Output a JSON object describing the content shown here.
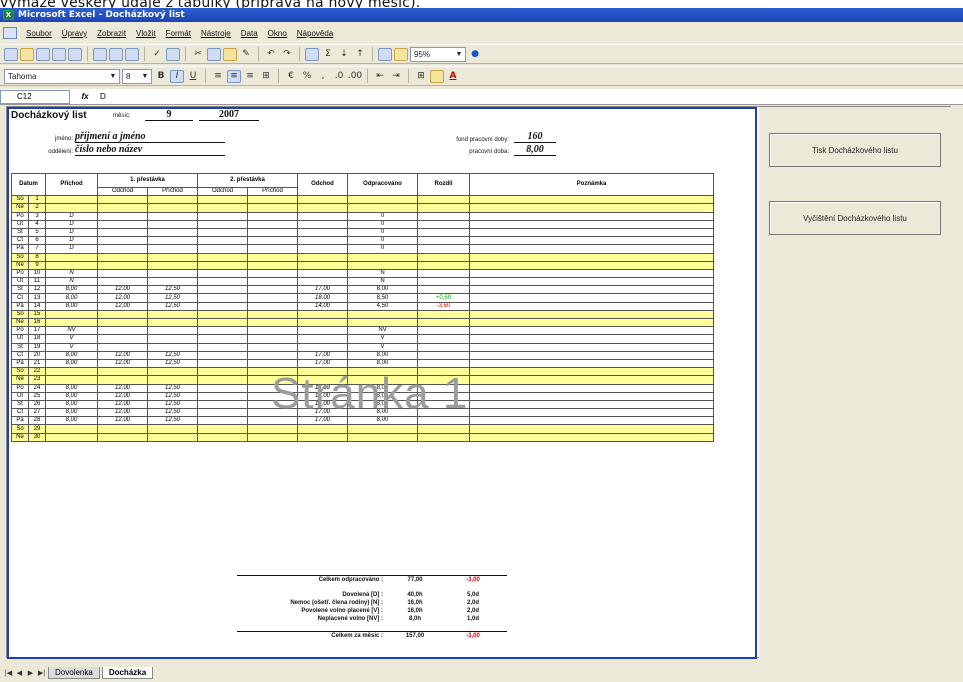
{
  "caption": "vymaže veškerý údaje z tabulky (příprava na nový měsíc).",
  "window": {
    "title": "Microsoft Excel - Docházkový list",
    "app_icon": "excel-icon"
  },
  "menu": [
    "Soubor",
    "Úpravy",
    "Zobrazit",
    "Vložit",
    "Formát",
    "Nástroje",
    "Data",
    "Okno",
    "Nápověda"
  ],
  "toolbar": {
    "zoom": "95%",
    "font": "Tahoma",
    "font_size": "8",
    "bold": "B",
    "italic": "I",
    "underline": "U"
  },
  "formula_bar": {
    "cell": "C12",
    "fx": "fx",
    "value": "D"
  },
  "sheet": {
    "title": "Docházkový list",
    "mesic_label": "měsíc:",
    "mesic": "9",
    "rok": "2007",
    "jmeno_label": "jméno:",
    "jmeno": "příjmení a jméno",
    "oddeleni_label": "oddělení:",
    "oddeleni": "číslo nebo název",
    "fond_label": "fond pracovní doby:",
    "fond": "160",
    "pracovni_doba_label": "pracovní doba:",
    "pracovni_doba": "8,00",
    "headers": {
      "datum": "Datum",
      "prichod": "Příchod",
      "prestavka1": "1. přestávka",
      "prestavka2": "2. přestávka",
      "odchod_sub": "Odchod",
      "prichod_sub": "Příchod",
      "odchod": "Odchod",
      "odpracovano": "Odpracováno",
      "rozdil": "Rozdíl",
      "poznamka": "Poznámka"
    },
    "rows": [
      {
        "d": "So",
        "n": "1",
        "w": true,
        "p": "",
        "o1": "",
        "p1": "",
        "o2": "",
        "p2": "",
        "od": "",
        "odp": "",
        "r": "",
        "rc": ""
      },
      {
        "d": "Ne",
        "n": "2",
        "w": true,
        "p": "",
        "o1": "",
        "p1": "",
        "o2": "",
        "p2": "",
        "od": "",
        "odp": "",
        "r": "",
        "rc": ""
      },
      {
        "d": "Po",
        "n": "3",
        "w": false,
        "p": "D",
        "o1": "",
        "p1": "",
        "o2": "",
        "p2": "",
        "od": "",
        "odp": "0",
        "r": "",
        "rc": ""
      },
      {
        "d": "Út",
        "n": "4",
        "w": false,
        "p": "D",
        "o1": "",
        "p1": "",
        "o2": "",
        "p2": "",
        "od": "",
        "odp": "0",
        "r": "",
        "rc": ""
      },
      {
        "d": "St",
        "n": "5",
        "w": false,
        "p": "D",
        "o1": "",
        "p1": "",
        "o2": "",
        "p2": "",
        "od": "",
        "odp": "0",
        "r": "",
        "rc": ""
      },
      {
        "d": "Čt",
        "n": "6",
        "w": false,
        "p": "D",
        "o1": "",
        "p1": "",
        "o2": "",
        "p2": "",
        "od": "",
        "odp": "0",
        "r": "",
        "rc": ""
      },
      {
        "d": "Pá",
        "n": "7",
        "w": false,
        "p": "D",
        "o1": "",
        "p1": "",
        "o2": "",
        "p2": "",
        "od": "",
        "odp": "0",
        "r": "",
        "rc": ""
      },
      {
        "d": "So",
        "n": "8",
        "w": true,
        "p": "",
        "o1": "",
        "p1": "",
        "o2": "",
        "p2": "",
        "od": "",
        "odp": "",
        "r": "",
        "rc": ""
      },
      {
        "d": "Ne",
        "n": "9",
        "w": true,
        "p": "",
        "o1": "",
        "p1": "",
        "o2": "",
        "p2": "",
        "od": "",
        "odp": "",
        "r": "",
        "rc": ""
      },
      {
        "d": "Po",
        "n": "10",
        "w": false,
        "p": "N",
        "o1": "",
        "p1": "",
        "o2": "",
        "p2": "",
        "od": "",
        "odp": "N",
        "r": "",
        "rc": ""
      },
      {
        "d": "Út",
        "n": "11",
        "w": false,
        "p": "N",
        "o1": "",
        "p1": "",
        "o2": "",
        "p2": "",
        "od": "",
        "odp": "N",
        "r": "",
        "rc": ""
      },
      {
        "d": "St",
        "n": "12",
        "w": false,
        "p": "8,00",
        "o1": "12,00",
        "p1": "12,50",
        "o2": "",
        "p2": "",
        "od": "17,00",
        "odp": "8,00",
        "r": "",
        "rc": ""
      },
      {
        "d": "Čt",
        "n": "13",
        "w": false,
        "p": "8,00",
        "o1": "12,00",
        "p1": "12,50",
        "o2": "",
        "p2": "",
        "od": "18,00",
        "odp": "8,50",
        "r": "+0,50",
        "rc": "pos"
      },
      {
        "d": "Pá",
        "n": "14",
        "w": false,
        "p": "8,00",
        "o1": "12,00",
        "p1": "12,50",
        "o2": "",
        "p2": "",
        "od": "14,00",
        "odp": "4,50",
        "r": "-3,50",
        "rc": "neg"
      },
      {
        "d": "So",
        "n": "15",
        "w": true,
        "p": "",
        "o1": "",
        "p1": "",
        "o2": "",
        "p2": "",
        "od": "",
        "odp": "",
        "r": "",
        "rc": ""
      },
      {
        "d": "Ne",
        "n": "16",
        "w": true,
        "p": "",
        "o1": "",
        "p1": "",
        "o2": "",
        "p2": "",
        "od": "",
        "odp": "",
        "r": "",
        "rc": ""
      },
      {
        "d": "Po",
        "n": "17",
        "w": false,
        "p": "NV",
        "o1": "",
        "p1": "",
        "o2": "",
        "p2": "",
        "od": "",
        "odp": "NV",
        "r": "",
        "rc": ""
      },
      {
        "d": "Út",
        "n": "18",
        "w": false,
        "p": "V",
        "o1": "",
        "p1": "",
        "o2": "",
        "p2": "",
        "od": "",
        "odp": "V",
        "r": "",
        "rc": ""
      },
      {
        "d": "St",
        "n": "19",
        "w": false,
        "p": "V",
        "o1": "",
        "p1": "",
        "o2": "",
        "p2": "",
        "od": "",
        "odp": "V",
        "r": "",
        "rc": ""
      },
      {
        "d": "Čt",
        "n": "20",
        "w": false,
        "p": "8,00",
        "o1": "12,00",
        "p1": "12,50",
        "o2": "",
        "p2": "",
        "od": "17,00",
        "odp": "8,00",
        "r": "",
        "rc": ""
      },
      {
        "d": "Pá",
        "n": "21",
        "w": false,
        "p": "8,00",
        "o1": "12,00",
        "p1": "12,50",
        "o2": "",
        "p2": "",
        "od": "17,00",
        "odp": "8,00",
        "r": "",
        "rc": ""
      },
      {
        "d": "So",
        "n": "22",
        "w": true,
        "p": "",
        "o1": "",
        "p1": "",
        "o2": "",
        "p2": "",
        "od": "",
        "odp": "",
        "r": "",
        "rc": ""
      },
      {
        "d": "Ne",
        "n": "23",
        "w": true,
        "p": "",
        "o1": "",
        "p1": "",
        "o2": "",
        "p2": "",
        "od": "",
        "odp": "",
        "r": "",
        "rc": ""
      },
      {
        "d": "Po",
        "n": "24",
        "w": false,
        "p": "8,00",
        "o1": "12,00",
        "p1": "12,50",
        "o2": "",
        "p2": "",
        "od": "17,00",
        "odp": "8,00",
        "r": "",
        "rc": ""
      },
      {
        "d": "Út",
        "n": "25",
        "w": false,
        "p": "8,00",
        "o1": "12,00",
        "p1": "12,50",
        "o2": "",
        "p2": "",
        "od": "17,00",
        "odp": "8,00",
        "r": "",
        "rc": ""
      },
      {
        "d": "St",
        "n": "26",
        "w": false,
        "p": "8,00",
        "o1": "12,00",
        "p1": "12,50",
        "o2": "",
        "p2": "",
        "od": "17,00",
        "odp": "8,00",
        "r": "",
        "rc": ""
      },
      {
        "d": "Čt",
        "n": "27",
        "w": false,
        "p": "8,00",
        "o1": "12,00",
        "p1": "12,50",
        "o2": "",
        "p2": "",
        "od": "17,00",
        "odp": "8,00",
        "r": "",
        "rc": ""
      },
      {
        "d": "Pá",
        "n": "28",
        "w": false,
        "p": "8,00",
        "o1": "12,00",
        "p1": "12,50",
        "o2": "",
        "p2": "",
        "od": "17,00",
        "odp": "8,00",
        "r": "",
        "rc": ""
      },
      {
        "d": "So",
        "n": "29",
        "w": true,
        "p": "",
        "o1": "",
        "p1": "",
        "o2": "",
        "p2": "",
        "od": "",
        "odp": "",
        "r": "",
        "rc": ""
      },
      {
        "d": "Ne",
        "n": "30",
        "w": true,
        "p": "",
        "o1": "",
        "p1": "",
        "o2": "",
        "p2": "",
        "od": "",
        "odp": "",
        "r": "",
        "rc": ""
      }
    ],
    "watermark": "Stránka 1",
    "summary": [
      {
        "label": "Celkem odpracováno :",
        "v1": "77,00",
        "v2": "-3,00",
        "v2c": "neg"
      },
      {
        "label": "",
        "v1": "",
        "v2": "",
        "v2c": ""
      },
      {
        "label": "Dovolená [D] :",
        "v1": "40,0h",
        "v2": "5,0d",
        "v2c": ""
      },
      {
        "label": "Nemoc (ošetř. člena rodiny) [N] :",
        "v1": "16,0h",
        "v2": "2,0d",
        "v2c": ""
      },
      {
        "label": "Povolené volno placené [V] :",
        "v1": "16,0h",
        "v2": "2,0d",
        "v2c": ""
      },
      {
        "label": "Neplacené volno [NV] :",
        "v1": "8,0h",
        "v2": "1,0d",
        "v2c": ""
      },
      {
        "label": "",
        "v1": "",
        "v2": "",
        "v2c": ""
      },
      {
        "label": "Celkem za měsíc :",
        "v1": "157,00",
        "v2": "-3,00",
        "v2c": "neg"
      }
    ]
  },
  "buttons": {
    "tisk": "Tisk Docházkového listu",
    "vycisteni": "Vyčištění Docházkového listu"
  },
  "tabs": [
    "Dovolenka",
    "Docházka"
  ],
  "colors": {
    "weekend": "#ffff99",
    "frame": "#1f3fb0",
    "positive": "#00aa00",
    "negative": "#dd0000"
  }
}
